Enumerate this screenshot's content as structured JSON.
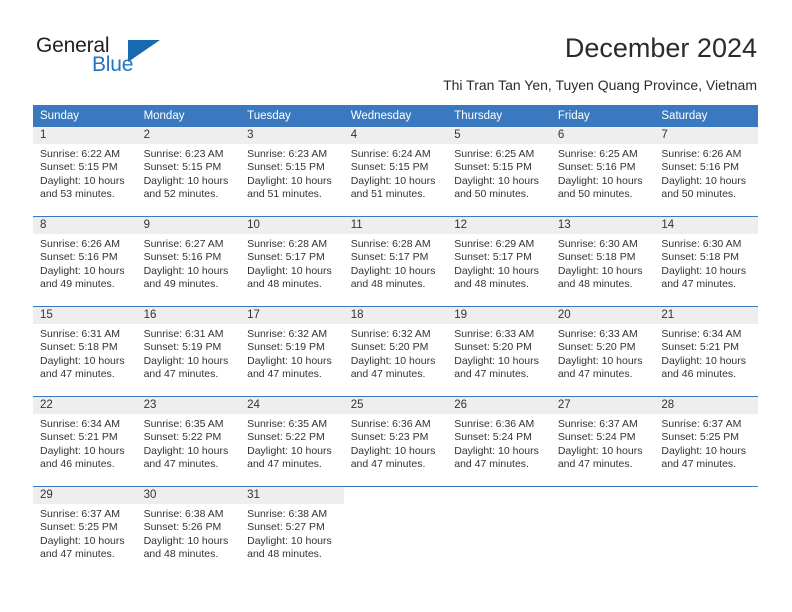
{
  "logo": {
    "word_one": "General",
    "word_two": "Blue",
    "triangle_color": "#1769b0",
    "text_color": "#231f20",
    "blue_text_color": "#2275c2"
  },
  "header": {
    "title": "December 2024",
    "subtitle": "Thi Tran Tan Yen, Tuyen Quang Province, Vietnam"
  },
  "theme": {
    "header_bg": "#3a79bf",
    "daynum_bg": "#eeeeee",
    "separator": "#3a79bf",
    "text": "#333333"
  },
  "calendar": {
    "weekday_headers": [
      "Sunday",
      "Monday",
      "Tuesday",
      "Wednesday",
      "Thursday",
      "Friday",
      "Saturday"
    ],
    "weeks": [
      [
        {
          "day": "1",
          "sunrise": "Sunrise: 6:22 AM",
          "sunset": "Sunset: 5:15 PM",
          "daylight_1": "Daylight: 10 hours",
          "daylight_2": "and 53 minutes."
        },
        {
          "day": "2",
          "sunrise": "Sunrise: 6:23 AM",
          "sunset": "Sunset: 5:15 PM",
          "daylight_1": "Daylight: 10 hours",
          "daylight_2": "and 52 minutes."
        },
        {
          "day": "3",
          "sunrise": "Sunrise: 6:23 AM",
          "sunset": "Sunset: 5:15 PM",
          "daylight_1": "Daylight: 10 hours",
          "daylight_2": "and 51 minutes."
        },
        {
          "day": "4",
          "sunrise": "Sunrise: 6:24 AM",
          "sunset": "Sunset: 5:15 PM",
          "daylight_1": "Daylight: 10 hours",
          "daylight_2": "and 51 minutes."
        },
        {
          "day": "5",
          "sunrise": "Sunrise: 6:25 AM",
          "sunset": "Sunset: 5:15 PM",
          "daylight_1": "Daylight: 10 hours",
          "daylight_2": "and 50 minutes."
        },
        {
          "day": "6",
          "sunrise": "Sunrise: 6:25 AM",
          "sunset": "Sunset: 5:16 PM",
          "daylight_1": "Daylight: 10 hours",
          "daylight_2": "and 50 minutes."
        },
        {
          "day": "7",
          "sunrise": "Sunrise: 6:26 AM",
          "sunset": "Sunset: 5:16 PM",
          "daylight_1": "Daylight: 10 hours",
          "daylight_2": "and 50 minutes."
        }
      ],
      [
        {
          "day": "8",
          "sunrise": "Sunrise: 6:26 AM",
          "sunset": "Sunset: 5:16 PM",
          "daylight_1": "Daylight: 10 hours",
          "daylight_2": "and 49 minutes."
        },
        {
          "day": "9",
          "sunrise": "Sunrise: 6:27 AM",
          "sunset": "Sunset: 5:16 PM",
          "daylight_1": "Daylight: 10 hours",
          "daylight_2": "and 49 minutes."
        },
        {
          "day": "10",
          "sunrise": "Sunrise: 6:28 AM",
          "sunset": "Sunset: 5:17 PM",
          "daylight_1": "Daylight: 10 hours",
          "daylight_2": "and 48 minutes."
        },
        {
          "day": "11",
          "sunrise": "Sunrise: 6:28 AM",
          "sunset": "Sunset: 5:17 PM",
          "daylight_1": "Daylight: 10 hours",
          "daylight_2": "and 48 minutes."
        },
        {
          "day": "12",
          "sunrise": "Sunrise: 6:29 AM",
          "sunset": "Sunset: 5:17 PM",
          "daylight_1": "Daylight: 10 hours",
          "daylight_2": "and 48 minutes."
        },
        {
          "day": "13",
          "sunrise": "Sunrise: 6:30 AM",
          "sunset": "Sunset: 5:18 PM",
          "daylight_1": "Daylight: 10 hours",
          "daylight_2": "and 48 minutes."
        },
        {
          "day": "14",
          "sunrise": "Sunrise: 6:30 AM",
          "sunset": "Sunset: 5:18 PM",
          "daylight_1": "Daylight: 10 hours",
          "daylight_2": "and 47 minutes."
        }
      ],
      [
        {
          "day": "15",
          "sunrise": "Sunrise: 6:31 AM",
          "sunset": "Sunset: 5:18 PM",
          "daylight_1": "Daylight: 10 hours",
          "daylight_2": "and 47 minutes."
        },
        {
          "day": "16",
          "sunrise": "Sunrise: 6:31 AM",
          "sunset": "Sunset: 5:19 PM",
          "daylight_1": "Daylight: 10 hours",
          "daylight_2": "and 47 minutes."
        },
        {
          "day": "17",
          "sunrise": "Sunrise: 6:32 AM",
          "sunset": "Sunset: 5:19 PM",
          "daylight_1": "Daylight: 10 hours",
          "daylight_2": "and 47 minutes."
        },
        {
          "day": "18",
          "sunrise": "Sunrise: 6:32 AM",
          "sunset": "Sunset: 5:20 PM",
          "daylight_1": "Daylight: 10 hours",
          "daylight_2": "and 47 minutes."
        },
        {
          "day": "19",
          "sunrise": "Sunrise: 6:33 AM",
          "sunset": "Sunset: 5:20 PM",
          "daylight_1": "Daylight: 10 hours",
          "daylight_2": "and 47 minutes."
        },
        {
          "day": "20",
          "sunrise": "Sunrise: 6:33 AM",
          "sunset": "Sunset: 5:20 PM",
          "daylight_1": "Daylight: 10 hours",
          "daylight_2": "and 47 minutes."
        },
        {
          "day": "21",
          "sunrise": "Sunrise: 6:34 AM",
          "sunset": "Sunset: 5:21 PM",
          "daylight_1": "Daylight: 10 hours",
          "daylight_2": "and 46 minutes."
        }
      ],
      [
        {
          "day": "22",
          "sunrise": "Sunrise: 6:34 AM",
          "sunset": "Sunset: 5:21 PM",
          "daylight_1": "Daylight: 10 hours",
          "daylight_2": "and 46 minutes."
        },
        {
          "day": "23",
          "sunrise": "Sunrise: 6:35 AM",
          "sunset": "Sunset: 5:22 PM",
          "daylight_1": "Daylight: 10 hours",
          "daylight_2": "and 47 minutes."
        },
        {
          "day": "24",
          "sunrise": "Sunrise: 6:35 AM",
          "sunset": "Sunset: 5:22 PM",
          "daylight_1": "Daylight: 10 hours",
          "daylight_2": "and 47 minutes."
        },
        {
          "day": "25",
          "sunrise": "Sunrise: 6:36 AM",
          "sunset": "Sunset: 5:23 PM",
          "daylight_1": "Daylight: 10 hours",
          "daylight_2": "and 47 minutes."
        },
        {
          "day": "26",
          "sunrise": "Sunrise: 6:36 AM",
          "sunset": "Sunset: 5:24 PM",
          "daylight_1": "Daylight: 10 hours",
          "daylight_2": "and 47 minutes."
        },
        {
          "day": "27",
          "sunrise": "Sunrise: 6:37 AM",
          "sunset": "Sunset: 5:24 PM",
          "daylight_1": "Daylight: 10 hours",
          "daylight_2": "and 47 minutes."
        },
        {
          "day": "28",
          "sunrise": "Sunrise: 6:37 AM",
          "sunset": "Sunset: 5:25 PM",
          "daylight_1": "Daylight: 10 hours",
          "daylight_2": "and 47 minutes."
        }
      ],
      [
        {
          "day": "29",
          "sunrise": "Sunrise: 6:37 AM",
          "sunset": "Sunset: 5:25 PM",
          "daylight_1": "Daylight: 10 hours",
          "daylight_2": "and 47 minutes."
        },
        {
          "day": "30",
          "sunrise": "Sunrise: 6:38 AM",
          "sunset": "Sunset: 5:26 PM",
          "daylight_1": "Daylight: 10 hours",
          "daylight_2": "and 48 minutes."
        },
        {
          "day": "31",
          "sunrise": "Sunrise: 6:38 AM",
          "sunset": "Sunset: 5:27 PM",
          "daylight_1": "Daylight: 10 hours",
          "daylight_2": "and 48 minutes."
        },
        {
          "day": "",
          "sunrise": "",
          "sunset": "",
          "daylight_1": "",
          "daylight_2": ""
        },
        {
          "day": "",
          "sunrise": "",
          "sunset": "",
          "daylight_1": "",
          "daylight_2": ""
        },
        {
          "day": "",
          "sunrise": "",
          "sunset": "",
          "daylight_1": "",
          "daylight_2": ""
        },
        {
          "day": "",
          "sunrise": "",
          "sunset": "",
          "daylight_1": "",
          "daylight_2": ""
        }
      ]
    ]
  }
}
